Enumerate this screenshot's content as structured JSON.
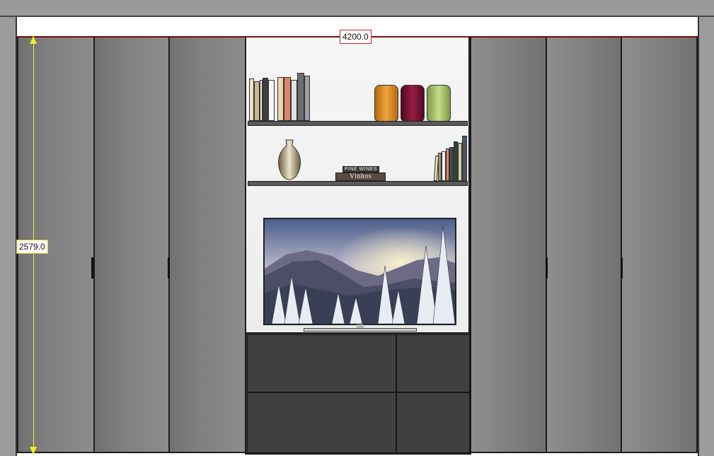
{
  "dimensions": {
    "width_label": "4200.0",
    "height_label": "2579.0"
  },
  "shelf_items": {
    "top_shelf": {
      "book_spines": [
        "Pine Wines",
        "Vinhos"
      ],
      "vase_colors": [
        "#d98a1c",
        "#7a1230",
        "#a9c46a"
      ]
    },
    "middle_shelf": {
      "book_stack_top": "PINE WINES",
      "book_stack_bottom": "Vinhos"
    }
  },
  "colors": {
    "door": "#7f7f7f",
    "cabinet": "#3a3a3a",
    "dimension_width": "#cc2222",
    "dimension_height": "#f2ee22"
  }
}
